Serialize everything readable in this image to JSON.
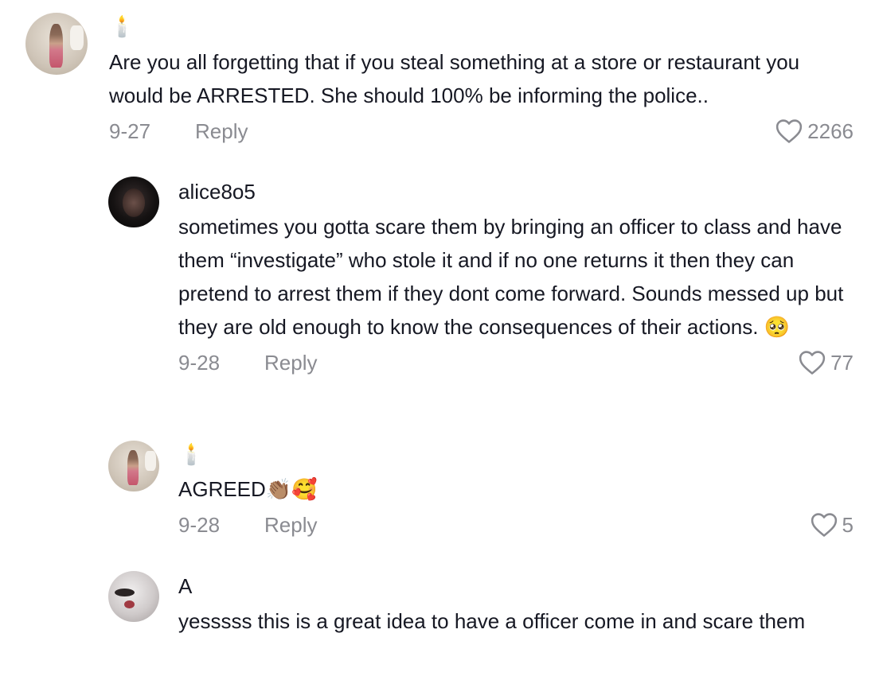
{
  "comments": [
    {
      "username": "🕯️",
      "text": "Are you all forgetting that if you steal something at a store or restaurant you would be ARRESTED. She should 100% be informing the police..",
      "date": "9-27",
      "reply_label": "Reply",
      "likes": "2266"
    },
    {
      "username": "alice8o5",
      "text": "sometimes you gotta scare them by bringing an officer to class and have them “investigate” who stole it and if no one returns it then they can pretend to arrest them if they dont come forward. Sounds messed up but they are old enough to know the consequences of their actions. 🥺",
      "date": "9-28",
      "reply_label": "Reply",
      "likes": "77"
    },
    {
      "username": "🕯️",
      "text": "AGREED👏🏽🥰",
      "date": "9-28",
      "reply_label": "Reply",
      "likes": "5"
    },
    {
      "username": "A",
      "text": "yesssss this is a great idea to have a officer come in and scare them"
    }
  ],
  "icons": {
    "heart": "heart-outline-icon"
  },
  "colors": {
    "text": "#161823",
    "meta": "#8a8b91"
  }
}
